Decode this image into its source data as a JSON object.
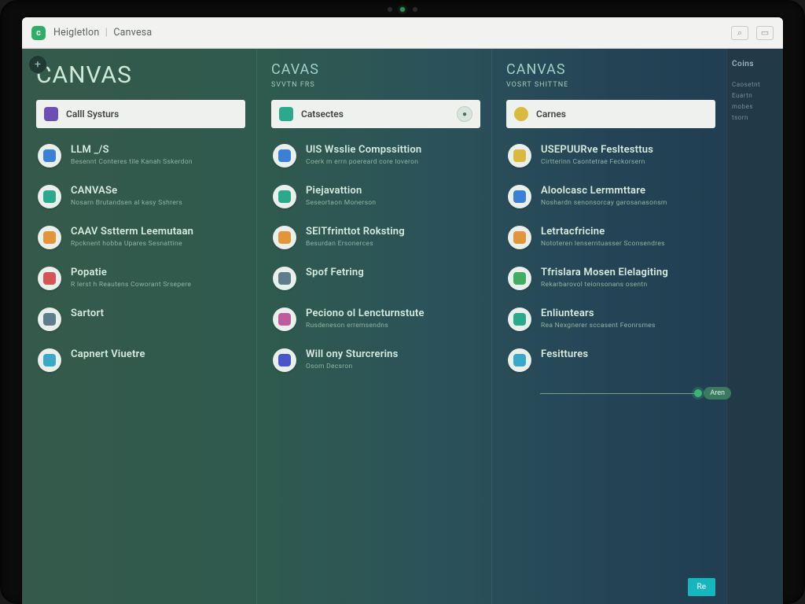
{
  "tabbar": {
    "app_glyph": "c",
    "title_a": "Heigletlon",
    "title_b": "Canvesa"
  },
  "mini_add": "+",
  "columns": [
    {
      "title": "CANVAS",
      "subtitle": "",
      "header": {
        "label": "Calll Systurs",
        "icon_color": "c-purple",
        "end_glyph": ""
      },
      "items": [
        {
          "label": "LLM _/S",
          "desc": "Besennt Conteres tile Kanah Sskerdon",
          "color": "c-blue"
        },
        {
          "label": "CANVASe",
          "desc": "Nosarn Brutandsen al kasy Sshrers",
          "color": "c-teal"
        },
        {
          "label": "CAAV Sstterm Leemutaan",
          "desc": "Rpcknent hobba Upares Sesnattine",
          "color": "c-orange"
        },
        {
          "label": "Popatie",
          "desc": "R lerst h Reautens Coworant Srsepere",
          "color": "c-red"
        },
        {
          "label": "Sartort",
          "desc": "",
          "color": "c-slate"
        },
        {
          "label": "Capnert Viuetre",
          "desc": "",
          "color": "c-cyan"
        }
      ]
    },
    {
      "title": "CAVAS",
      "subtitle": "SVVTN FRS",
      "header": {
        "label": "Catsectes",
        "icon_color": "c-teal",
        "end_glyph": "●"
      },
      "items": [
        {
          "label": "UlS Wsslie Compssittion",
          "desc": "Coerk m errn poereard core loveron",
          "color": "c-blue"
        },
        {
          "label": "Piejavattion",
          "desc": "Seseortaon Monerson",
          "color": "c-teal"
        },
        {
          "label": "SElTfrinttot Roksting",
          "desc": "Besurdan Ersonerces",
          "color": "c-orange"
        },
        {
          "label": "Spof Fetring",
          "desc": "",
          "color": "c-slate"
        },
        {
          "label": "Peciono ol Lencturnstute",
          "desc": "Rusdeneson erremsendns",
          "color": "c-pink"
        },
        {
          "label": "Will ony Sturcrerins",
          "desc": "Osom Decsron",
          "color": "c-indigo"
        }
      ]
    },
    {
      "title": "CANVAS",
      "subtitle": "Vosrt Shittne",
      "header": {
        "label": "Carnes",
        "icon_color": "c-yellow",
        "end_glyph": ""
      },
      "items": [
        {
          "label": "USEPUURve Fesltesttus",
          "desc": "Cirtterinn Caontetrae Feckorsern",
          "color": "c-yellow"
        },
        {
          "label": "Aloolcasc Lermmttare",
          "desc": "Noshardn senonsorcay garosanasonsm",
          "color": "c-blue"
        },
        {
          "label": "Letrtacfricine",
          "desc": "Nototeren lenserntuasser Sconsendres",
          "color": "c-orange"
        },
        {
          "label": "Tfrislara Mosen Elelagiting",
          "desc": "Rekarbarovol teionsonans osentn",
          "color": "c-green"
        },
        {
          "label": "Enliuntears",
          "desc": "Rea Nexgnerer sccasent Feonrsmes",
          "color": "c-teal"
        },
        {
          "label": "Fesittures",
          "desc": "",
          "color": "c-cyan"
        }
      ]
    }
  ],
  "rail": {
    "head": "Coins",
    "items": [
      "Caosetnt",
      "Euartn",
      "mobes",
      "tsorn",
      "",
      "",
      ""
    ]
  },
  "float_chip": "Aren",
  "bottom_cta": "Re"
}
